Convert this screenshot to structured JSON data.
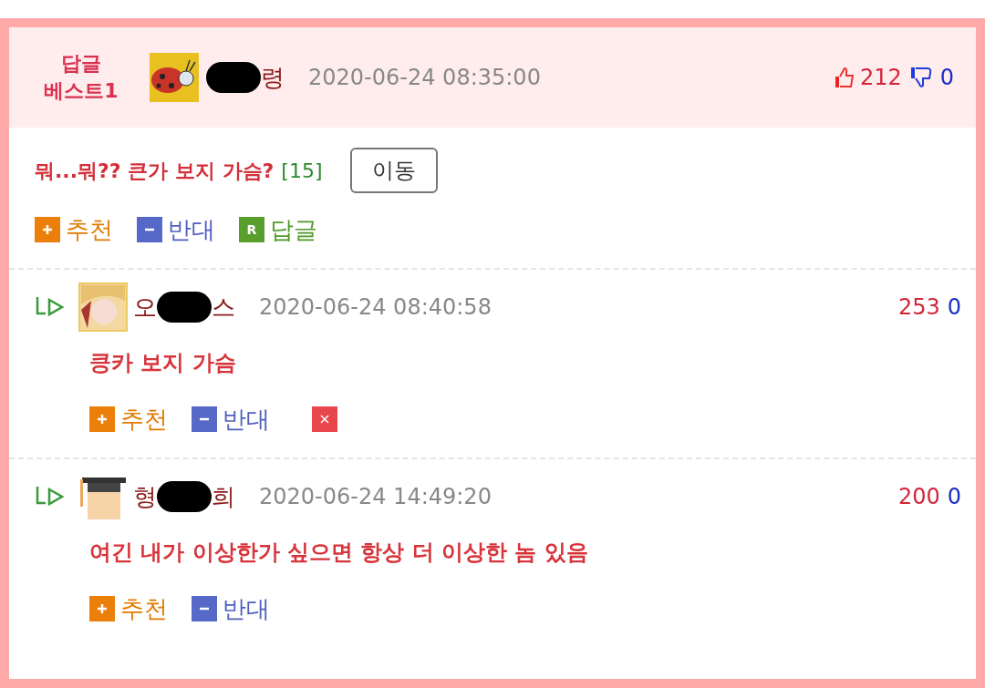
{
  "best": {
    "badge": [
      "답글",
      "베스트1"
    ],
    "avatar": {
      "kind": "ladybug"
    },
    "author": [
      {
        "kind": "redacted"
      },
      {
        "kind": "text",
        "text": "령"
      }
    ],
    "time": "2020-06-24 08:35:00",
    "up": "212",
    "down": "0",
    "title": "뭐...뭐?? 큰가 보지 가슴?",
    "comment_count": "[15]",
    "move_button": "이동",
    "actions": [
      {
        "kind": "up",
        "label": "추천"
      },
      {
        "kind": "down",
        "label": "반대"
      },
      {
        "kind": "reply",
        "label": "답글",
        "icon_text": "R"
      }
    ]
  },
  "replies": [
    {
      "avatar": {
        "kind": "character"
      },
      "author": [
        {
          "kind": "text",
          "text": "오"
        },
        {
          "kind": "redacted"
        },
        {
          "kind": "text",
          "text": "스"
        }
      ],
      "time": "2020-06-24 08:40:58",
      "up": "253",
      "down": "0",
      "text": "킁카 보지 가슴",
      "actions": [
        {
          "kind": "up",
          "label": "추천"
        },
        {
          "kind": "down",
          "label": "반대"
        },
        {
          "kind": "delete"
        }
      ]
    },
    {
      "avatar": {
        "kind": "scholar"
      },
      "author": [
        {
          "kind": "text",
          "text": "형"
        },
        {
          "kind": "redacted"
        },
        {
          "kind": "text",
          "text": "희"
        }
      ],
      "time": "2020-06-24 14:49:20",
      "up": "200",
      "down": "0",
      "text": "여긴 내가 이상한가 싶으면 항상 더 이상한 놈 있음",
      "actions": [
        {
          "kind": "up",
          "label": "추천"
        },
        {
          "kind": "down",
          "label": "반대"
        }
      ]
    }
  ]
}
